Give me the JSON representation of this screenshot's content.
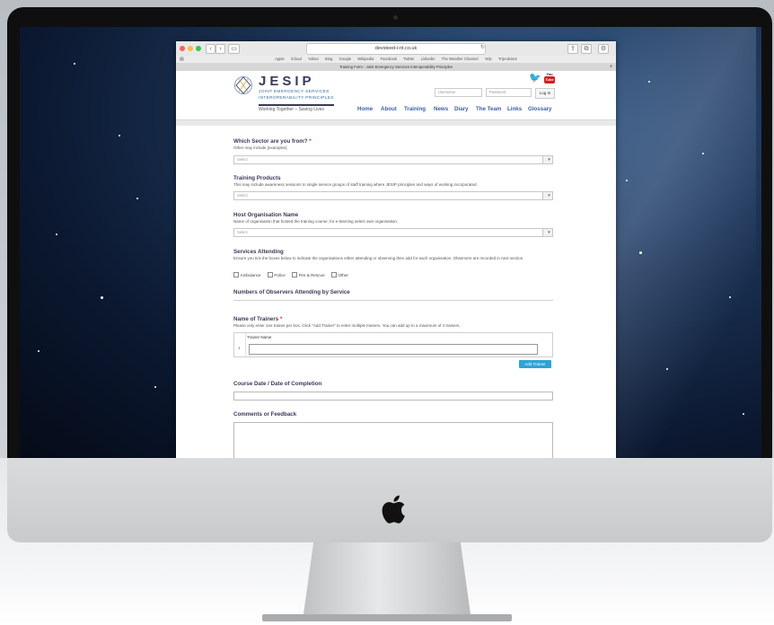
{
  "browser": {
    "url": "devsteed-i-nt.co.uk",
    "bookmarks": [
      "Apple",
      "iCloud",
      "Yahoo",
      "Bing",
      "Google",
      "Wikipedia",
      "Facebook",
      "Twitter",
      "LinkedIn",
      "The Weather Channel",
      "Yelp",
      "TripAdvisor"
    ],
    "tab_title": "Training Form - Joint Emergency Services Interoperability Principles"
  },
  "site": {
    "brand": "JESIP",
    "brand_line1": "JOINT EMERGENCY SERVICES",
    "brand_line2": "INTEROPERABILITY PRINCIPLES",
    "tagline": "Working Together – Saving Lives",
    "username_placeholder": "Username",
    "password_placeholder": "Password",
    "login_label": "Log In",
    "youtube_top": "You",
    "youtube_box": "Tube",
    "nav": [
      "Home",
      "About",
      "Training",
      "News",
      "Diary",
      "The Team",
      "Links",
      "Glossary"
    ]
  },
  "form": {
    "sector": {
      "title": "Which Sector are you from?",
      "required_mark": "*",
      "help": "Other may include [examples]",
      "select_value": "Select"
    },
    "products": {
      "title": "Training Products",
      "help": "This may include awareness sessions to single service groups of staff training where JESIP principles and ways of working incorporated.",
      "select_value": "Select"
    },
    "host": {
      "title": "Host Organisation Name",
      "help": "Name of organisation that hosted the training course, for e-learning select own organisation.",
      "select_value": "Select"
    },
    "services": {
      "title": "Services Attending",
      "help": "Ensure you tick the boxes below to indicate the organisations either attending or observing then add for each organisation. Observers are recorded in next section.",
      "options": [
        "Ambulance",
        "Police",
        "Fire & Rescue",
        "Other"
      ]
    },
    "observers": {
      "title": "Numbers of Observers Attending by Service"
    },
    "trainers": {
      "title": "Name of Trainers",
      "required_mark": "*",
      "help": "Please only enter one trainer per box. Click \"Add Trainer\" to enter multiple trainers. You can add up to a maximum of 4 trainers.",
      "column_header": "Trainer Name",
      "row_number": "1",
      "add_label": "Add Trainer"
    },
    "course_date": {
      "title": "Course Date / Date of Completion"
    },
    "comments": {
      "title": "Comments or Feedback"
    }
  },
  "colors": {
    "nav_link": "#3d5fa8",
    "required": "#d9302c",
    "add_button": "#2fa3d6"
  }
}
